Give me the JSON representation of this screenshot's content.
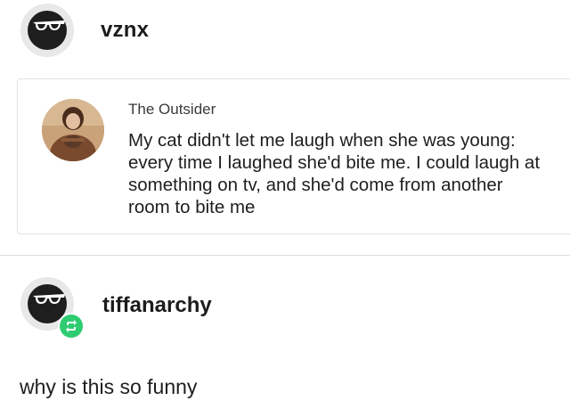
{
  "post": {
    "username": "vznx",
    "avatar_icon": "sunglasses-icon"
  },
  "quote": {
    "author": "The Outsider",
    "text": "My cat didn't let me laugh when she was young: every time I laughed she'd bite me. I could laugh at something on tv, and she'd come from another room to bite me"
  },
  "reblog": {
    "username": "tiffanarchy",
    "avatar_icon": "sunglasses-icon",
    "badge_icon": "reblog-icon",
    "badge_color": "#2ecc71",
    "comment": "why is this so funny"
  }
}
